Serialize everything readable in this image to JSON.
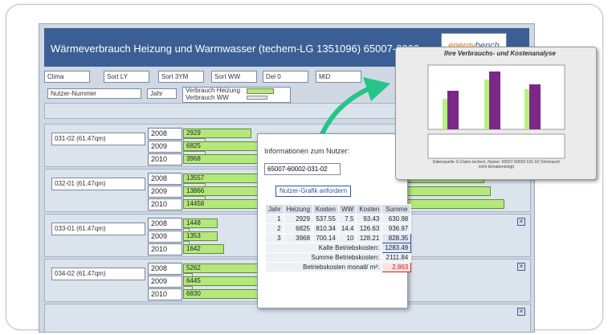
{
  "app": {
    "title": "Wärmeverbrauch Heizung und Warmwasser (techem-LG 1351096) 65007-6000",
    "logo": "energy bench"
  },
  "toolbar": [
    "Clima",
    "Sort LY",
    "Sort 3YM",
    "Sort WW",
    "Del 0",
    "MiD"
  ],
  "header": {
    "nutzer_label": "Nutzer-Nummer",
    "jahr_label": "Jahr",
    "legend_heizung": "Verbrauch Heizung",
    "legend_ww": "Verbrauch WW"
  },
  "units": [
    {
      "name": "031-02 (61.47qm)",
      "rows": [
        {
          "year": "2008",
          "value": "2929",
          "fill": 0.19
        },
        {
          "year": "2009",
          "value": "6825",
          "fill": 0.44
        },
        {
          "year": "2010",
          "value": "3968",
          "fill": 0.26
        }
      ]
    },
    {
      "name": "032-01 (61.47qm)",
      "rows": [
        {
          "year": "2008",
          "value": "13557",
          "fill": 0.88
        },
        {
          "year": "2009",
          "value": "13866",
          "fill": 0.9
        },
        {
          "year": "2010",
          "value": "14458",
          "fill": 0.94
        }
      ]
    },
    {
      "name": "033-01 (61.47qm)",
      "rows": [
        {
          "year": "2008",
          "value": "1448",
          "fill": 0.09
        },
        {
          "year": "2009",
          "value": "1353",
          "fill": 0.09
        },
        {
          "year": "2010",
          "value": "1642",
          "fill": 0.11
        }
      ]
    },
    {
      "name": "034-02 (61.47qm)",
      "rows": [
        {
          "year": "2008",
          "value": "5262",
          "fill": 0.34
        },
        {
          "year": "2009",
          "value": "6445",
          "fill": 0.42
        },
        {
          "year": "2010",
          "value": "6830",
          "fill": 0.44
        }
      ]
    }
  ],
  "popup": {
    "label": "Informationen zum Nutzer:",
    "nutzer_value": "65007-60002-031-02",
    "button": "Nutzer-Grafik anfordern",
    "columns": [
      "Jahr",
      "Heizung",
      "Kosten",
      "WW",
      "Kosten",
      "Summe"
    ],
    "rows": [
      [
        "1",
        "2929",
        "537.55",
        "7.5",
        "93.43",
        "630.98"
      ],
      [
        "2",
        "6825",
        "810.34",
        "14.4",
        "126.63",
        "936.97"
      ],
      [
        "3",
        "3968",
        "700.14",
        "10",
        "128.21",
        "828.35"
      ]
    ],
    "kalte_label": "Kalte Betriebskosten:",
    "kalte_value": "1283.49",
    "summe_label": "Summe Betriebskosten:",
    "summe_value": "2111.84",
    "monat_label": "Betriebskosten monatl/ m²:",
    "monat_value": "2.863"
  },
  "chart": {
    "title": "Ihre Verbrauchs- und Kostenanalyse",
    "source": "Datenquelle: E-Daten techem, Nutzer: 65007-60002-031-02 (Verbrauch nicht klimabereinigt)"
  },
  "colors": {
    "titlebar": "#3b5f95",
    "bar": "#b4e87c",
    "arrow": "#27c48a"
  }
}
